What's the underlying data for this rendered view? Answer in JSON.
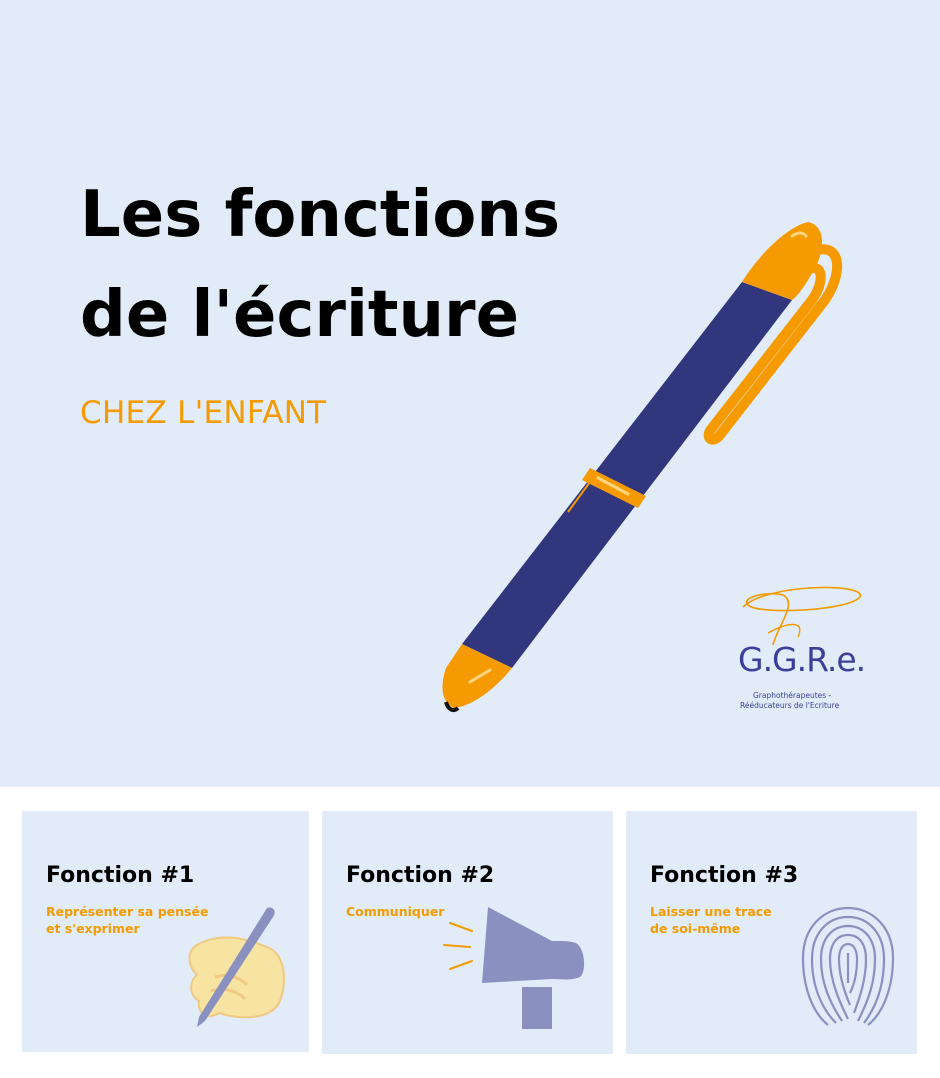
{
  "hero": {
    "title_line1": "Les fonctions",
    "title_line2": "de l'écriture",
    "subtitle": "CHEZ L'ENFANT",
    "illustration": "pen-icon"
  },
  "logo": {
    "letters": "G.G.R.e.",
    "line1": "Graphothérapeutes -",
    "line2": "Rééducateurs de l'Ecriture"
  },
  "cards": [
    {
      "title": "Fonction #1",
      "desc": "Représenter sa pensée\net s'exprimer",
      "icon": "hand-writing-icon"
    },
    {
      "title": "Fonction #2",
      "desc": "Communiquer",
      "icon": "megaphone-icon"
    },
    {
      "title": "Fonction #3",
      "desc": "Laisser une trace\nde soi-même",
      "icon": "fingerprint-icon"
    }
  ],
  "colors": {
    "background": "#e1ecf8",
    "accent": "#f59a00",
    "pen_body": "#32367c",
    "logo": "#3b3f9a",
    "illustration": "#8a91c1"
  }
}
